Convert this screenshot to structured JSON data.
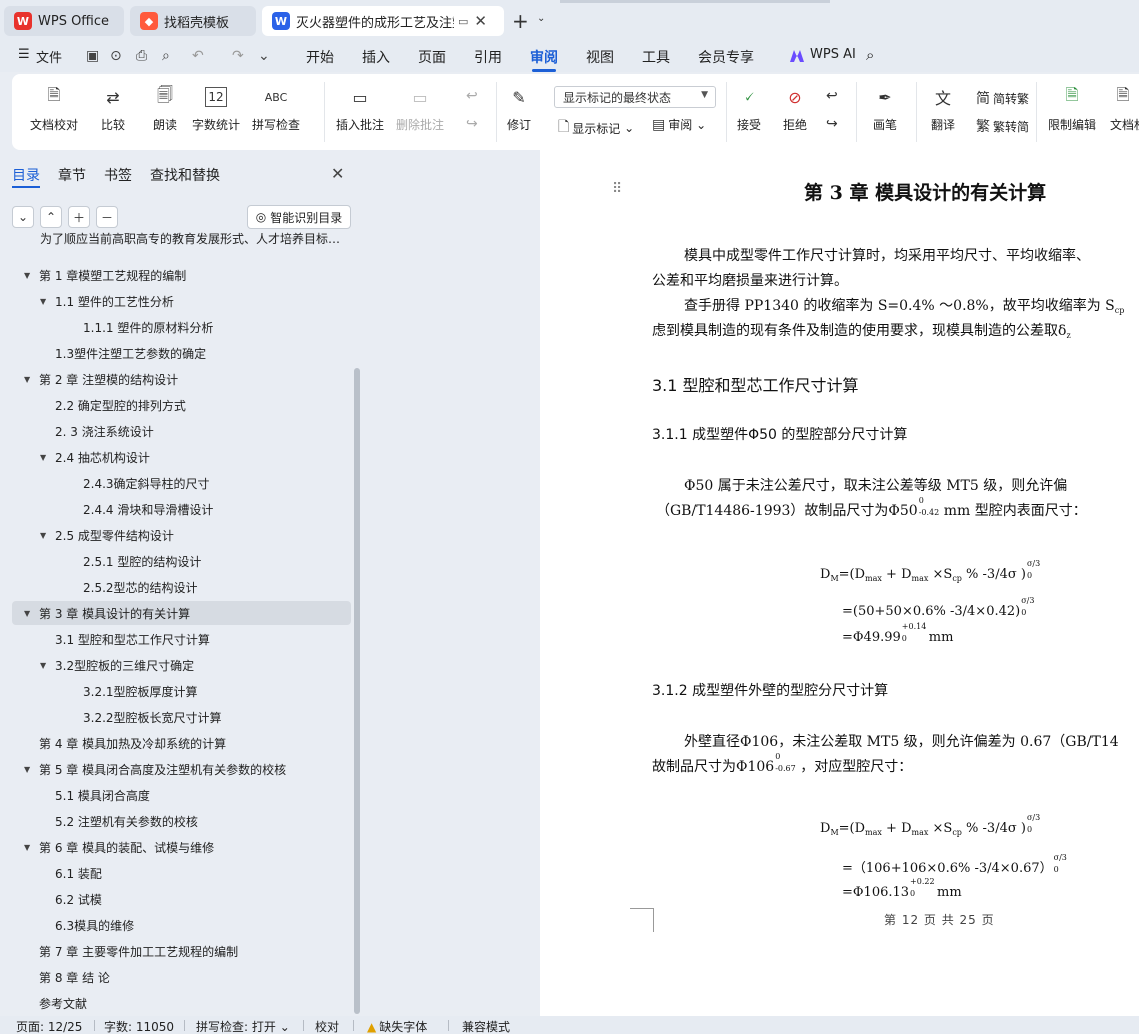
{
  "tabs": {
    "wps_label": "WPS Office",
    "template_label": "找稻壳模板",
    "doc_label": "灭火器塑件的成形工艺及注塑模",
    "new_tab": "+"
  },
  "menu": {
    "file_label": "文件",
    "items": [
      "开始",
      "插入",
      "页面",
      "引用",
      "审阅",
      "视图",
      "工具",
      "会员专享"
    ],
    "active": "审阅",
    "ai_label": "WPS AI"
  },
  "ribbon": {
    "doc_check": "文档校对",
    "compare": "比较",
    "read_aloud": "朗读",
    "word_count": "字数统计",
    "word_count_icon_text": "12",
    "spell_check": "拼写检查",
    "spell_icon_text": "ABC",
    "insert_comment": "插入批注",
    "delete_comment": "删除批注",
    "revise": "修订",
    "markup_state": "显示标记的最终状态",
    "show_markup": "显示标记",
    "review": "审阅",
    "accept": "接受",
    "reject": "拒绝",
    "pen": "画笔",
    "translate": "翻译",
    "trad_simp": "繁转简",
    "simp_trad": "简转繁",
    "restrict_edit": "限制编辑",
    "doc_permission": "文档权限"
  },
  "panel": {
    "tabs": [
      "目录",
      "章节",
      "书签",
      "查找和替换"
    ],
    "active_tab": "目录",
    "smart_toc": "智能识别目录",
    "toc_items": [
      {
        "text": "为了顺应当前高职高专的教育发展形式、人才培养目标…",
        "level": 0,
        "arrow": ""
      },
      {
        "text": "第 1 章模塑工艺规程的编制",
        "level": 0,
        "arrow": "▼"
      },
      {
        "text": "1.1  塑件的工艺性分析",
        "level": 1,
        "arrow": "▼"
      },
      {
        "text": "1.1.1   塑件的原材料分析",
        "level": 2,
        "arrow": ""
      },
      {
        "text": "1.3塑件注塑工艺参数的确定",
        "level": 1,
        "arrow": ""
      },
      {
        "text": "第 2 章  注塑模的结构设计",
        "level": 0,
        "arrow": "▼"
      },
      {
        "text": "2.2  确定型腔的排列方式",
        "level": 1,
        "arrow": ""
      },
      {
        "text": "2.  3  浇注系统设计",
        "level": 1,
        "arrow": ""
      },
      {
        "text": "2.4  抽芯机构设计",
        "level": 1,
        "arrow": "▼"
      },
      {
        "text": "2.4.3确定斜导柱的尺寸",
        "level": 2,
        "arrow": ""
      },
      {
        "text": "2.4.4  滑块和导滑槽设计",
        "level": 2,
        "arrow": ""
      },
      {
        "text": "2.5  成型零件结构设计",
        "level": 1,
        "arrow": "▼"
      },
      {
        "text": "2.5.1  型腔的结构设计",
        "level": 2,
        "arrow": ""
      },
      {
        "text": "2.5.2型芯的结构设计",
        "level": 2,
        "arrow": ""
      },
      {
        "text": "第 3 章  模具设计的有关计算",
        "level": 0,
        "arrow": "▼",
        "selected": true
      },
      {
        "text": "3.1  型腔和型芯工作尺寸计算",
        "level": 1,
        "arrow": ""
      },
      {
        "text": "3.2型腔板的三维尺寸确定",
        "level": 1,
        "arrow": "▼"
      },
      {
        "text": "3.2.1型腔板厚度计算",
        "level": 2,
        "arrow": ""
      },
      {
        "text": "3.2.2型腔板长宽尺寸计算",
        "level": 2,
        "arrow": ""
      },
      {
        "text": "第 4 章  模具加热及冷却系统的计算",
        "level": 0,
        "arrow": ""
      },
      {
        "text": "第 5 章  模具闭合高度及注塑机有关参数的校核",
        "level": 0,
        "arrow": "▼"
      },
      {
        "text": "5.1  模具闭合高度",
        "level": 1,
        "arrow": ""
      },
      {
        "text": "5.2  注塑机有关参数的校核",
        "level": 1,
        "arrow": ""
      },
      {
        "text": "第 6 章  模具的装配、试模与维修",
        "level": 0,
        "arrow": "▼"
      },
      {
        "text": "6.1  装配",
        "level": 1,
        "arrow": ""
      },
      {
        "text": "6.2  试模",
        "level": 1,
        "arrow": ""
      },
      {
        "text": "6.3模具的维修",
        "level": 1,
        "arrow": ""
      },
      {
        "text": "第 7 章  主要零件加工工艺规程的编制",
        "level": 0,
        "arrow": ""
      },
      {
        "text": "第 8 章  结    论",
        "level": 0,
        "arrow": ""
      },
      {
        "text": "参考文献",
        "level": 0,
        "arrow": ""
      }
    ]
  },
  "doc": {
    "title": "第 3 章  模具设计的有关计算",
    "p1_line1": "模具中成型零件工作尺寸计算时，均采用平均尺寸、平均收缩率、",
    "p1_line2": "公差和平均磨损量来进行计算。",
    "p2_line1": "查手册得 PP1340 的收缩率为 S=0.4% ～0.8%，故平均收缩率为 S",
    "p2_sub1": "cp",
    "p2_line2": "虑到模具制造的现有条件及制造的使用要求，现模具制造的公差取δ",
    "p2_sub2": "z",
    "h2": "3.1  型腔和型芯工作尺寸计算",
    "h3_1": "3.1.1  成型塑件Φ50 的型腔部分尺寸计算",
    "p3_line1": "Φ50 属于未注公差尺寸，取未注公差等级 MT5 级，则允许偏",
    "p3_line2a": "（GB/T14486-1993）故制品尺寸为Φ50",
    "p3_tol_up": "0",
    "p3_tol_dn": "-0.42",
    "p3_line2b": "mm 型腔内表面尺寸：",
    "f1_l1_a": "D",
    "f1_l1_a_sub": "M",
    "f1_l1_b": "=(D",
    "f1_l1_b_sub": "max",
    "f1_l1_c": " + D",
    "f1_l1_c_sub": "max",
    "f1_l1_d": " ×S",
    "f1_l1_d_sub": "cp",
    "f1_l1_e": " % -3/4σ )",
    "f1_l1_tol_up": "σ/3",
    "f1_l1_tol_dn": "0",
    "f1_l2": "=(50+50×0.6% -3/4×0.42)",
    "f1_l2_tol_up": "σ/3",
    "f1_l2_tol_dn": "0",
    "f1_l3a": "=Φ49.99",
    "f1_l3_tol_up": "+0.14",
    "f1_l3_tol_dn": "0",
    "f1_l3b": "mm",
    "h3_2": "3.1.2  成型塑件外壁的型腔分尺寸计算",
    "p4_line1": "外壁直径Φ106，未注公差取 MT5 级，则允许偏差为 0.67（GB/T14",
    "p4_line2a": "故制品尺寸为Φ106",
    "p4_tol_up": "0",
    "p4_tol_dn": "-0.67",
    "p4_line2b": "，对应型腔尺寸：",
    "f2_l2": "=（106+106×0.6% -3/4×0.67）",
    "f2_l2_tol_up": "σ/3",
    "f2_l2_tol_dn": "0",
    "f2_l3a": "=Φ106.13",
    "f2_l3_tol_up": "+0.22",
    "f2_l3_tol_dn": "0",
    "f2_l3b": "mm",
    "page_footer": "第 12 页 共 25 页"
  },
  "status": {
    "page": "页面: 12/25",
    "words": "字数: 11050",
    "spell": "拼写检查: 打开",
    "proof": "校对",
    "missing_font": "缺失字体",
    "compat": "兼容模式"
  }
}
